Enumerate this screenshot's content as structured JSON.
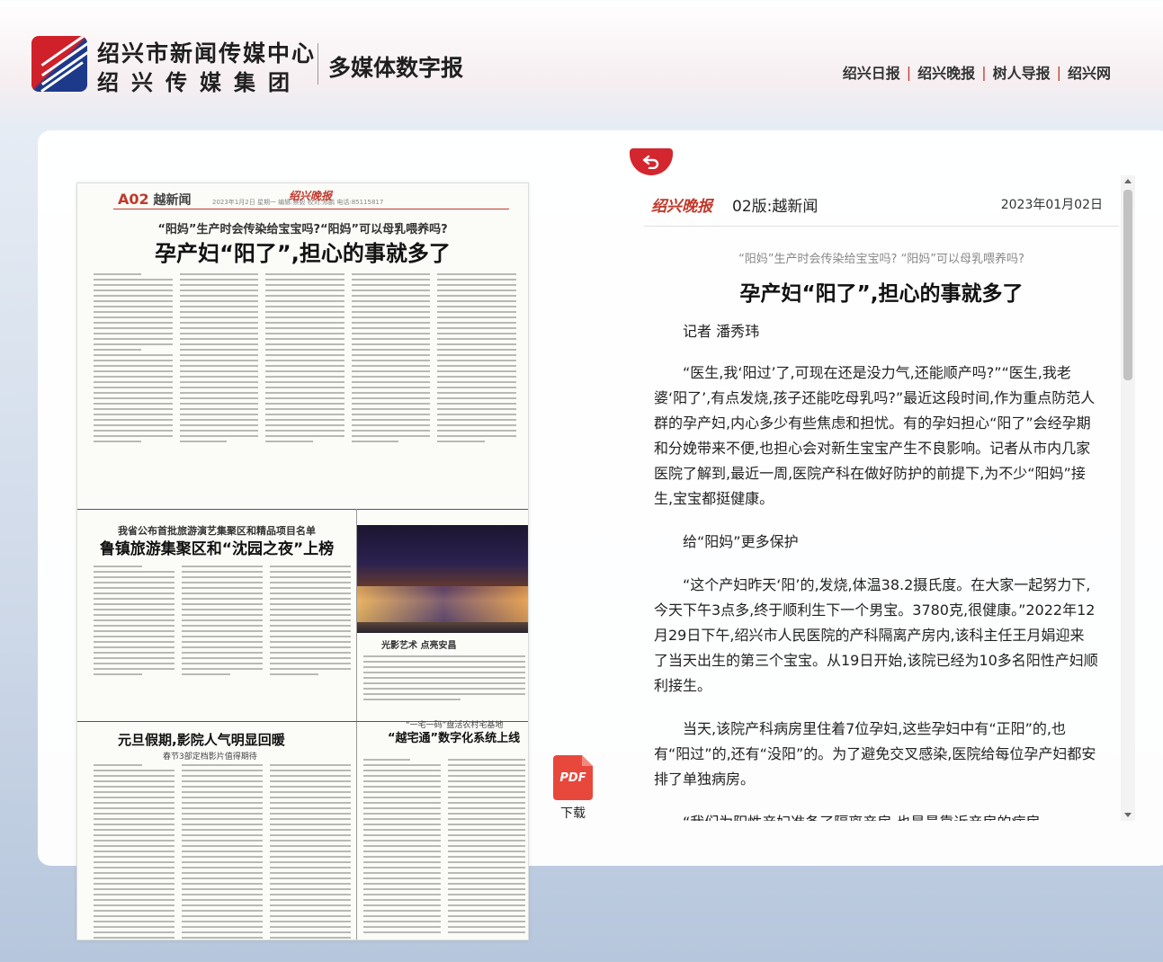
{
  "header": {
    "org_name": "绍兴市新闻传媒中心",
    "group_name": "绍兴传媒集团",
    "product_name": "多媒体数字报",
    "nav": [
      "绍兴日报",
      "绍兴晚报",
      "树人导报",
      "绍兴网"
    ]
  },
  "paper_page": {
    "page_no": "A02",
    "section": "越新闻",
    "brand": "绍兴晚报",
    "info": "2023年1月2日  星期一  编辑:蔡毅 校对:郑鹏 电话:85115817",
    "story1_sub": "“阳妈”生产时会传染给宝宝吗?“阳妈”可以母乳喂养吗?",
    "story1_title": "孕产妇“阳了”,担心的事就多了",
    "story2_sub": "我省公布首批旅游演艺集聚区和精品项目名单",
    "story2_title": "鲁镇旅游集聚区和“沈园之夜”上榜",
    "photo_caption": "光影艺术  点亮安昌",
    "story3_title": "元旦假期,影院人气明显回暖",
    "story3_sub": "春节3部定档影片值得期待",
    "story4_sub": "“一宅一码”盘活农村宅基地",
    "story4_title": "“越宅通”数字化系统上线"
  },
  "pdf": {
    "icon_text": "PDF",
    "label": "下载"
  },
  "article": {
    "brand": "绍兴晚报",
    "page_label": "02版:越新闻",
    "date": "2023年01月02日",
    "subtitle": "“阳妈”生产时会传染给宝宝吗? “阳妈”可以母乳喂养吗?",
    "title": "孕产妇“阳了”,担心的事就多了",
    "author": "记者 潘秀玮",
    "paragraphs": [
      "“医生,我‘阳过’了,可现在还是没力气,还能顺产吗?”“医生,我老婆‘阳了’,有点发烧,孩子还能吃母乳吗?”最近这段时间,作为重点防范人群的孕产妇,内心多少有些焦虑和担忧。有的孕妇担心“阳了”会经孕期和分娩带来不便,也担心会对新生宝宝产生不良影响。记者从市内几家医院了解到,最近一周,医院产科在做好防护的前提下,为不少“阳妈”接生,宝宝都挺健康。",
      "给“阳妈”更多保护",
      "“这个产妇昨天‘阳’的,发烧,体温38.2摄氏度。在大家一起努力下,今天下午3点多,终于顺利生下一个男宝。3780克,很健康。”2022年12月29日下午,绍兴市人民医院的产科隔离产房内,该科主任王月娟迎来了当天出生的第三个宝宝。从19日开始,该院已经为10多名阳性产妇顺利接生。",
      "当天,该院产科病房里住着7位孕妇,这些孕妇中有“正阳”的,也有“阳过”的,还有“没阳”的。为了避免交叉感染,医院给每位孕产妇都安排了单独病房。",
      "“我们为阳性产妇准备了隔离产房,也是最靠近产房的病房。"
    ]
  },
  "colors": {
    "accent": "#d3262e",
    "pdf": "#e8473c"
  }
}
